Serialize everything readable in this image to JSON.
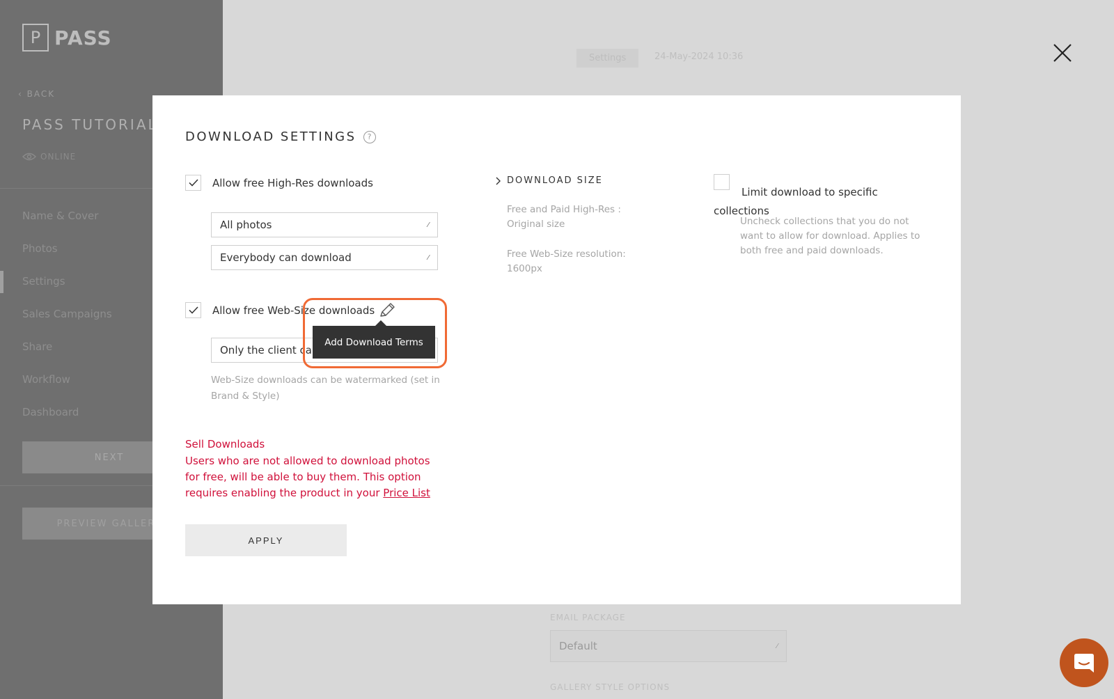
{
  "background": {
    "logo_letter": "P",
    "logo_text": "PASS",
    "back_label": "BACK",
    "gallery_title": "PASS TUTORIALS",
    "status": "ONLINE",
    "nav_items": [
      "Name & Cover",
      "Photos",
      "Settings",
      "Sales Campaigns",
      "Share",
      "Workflow",
      "Dashboard"
    ],
    "next_label": "NEXT",
    "preview_label": "PREVIEW GALLERY",
    "tab_label": "Settings",
    "date": "24-May-2024 10:36",
    "email_package_label": "EMAIL PACKAGE",
    "email_package_value": "Default",
    "gallery_style_label": "GALLERY STYLE OPTIONS"
  },
  "modal": {
    "title": "DOWNLOAD SETTINGS",
    "help_glyph": "?",
    "high_res": {
      "label": "Allow free High-Res downloads",
      "checked": true,
      "photos_select": "All photos",
      "who_select": "Everybody can download"
    },
    "web_size": {
      "label": "Allow free Web-Size downloads",
      "checked": true,
      "who_select": "Only the client can",
      "hint": "Web-Size downloads can be watermarked (set in Brand & Style)"
    },
    "tooltip": "Add Download Terms",
    "sell": {
      "title": "Sell Downloads",
      "text": "Users who are not allowed to download photos for free, will be able to buy them. This option requires enabling the product in your",
      "link": "Price List"
    },
    "apply_label": "APPLY",
    "download_size": {
      "heading": "DOWNLOAD SIZE",
      "high_res_label": "Free and Paid High-Res :",
      "high_res_value": "Original size",
      "web_label": "Free Web-Size resolution:",
      "web_value": "1600px"
    },
    "limit": {
      "label": "Limit download to specific collections",
      "checked": false,
      "hint": "Uncheck collections that you do not want to allow for download. Applies to both free and paid downloads."
    }
  },
  "colors": {
    "accent_red": "#d0103a",
    "highlight_orange": "#f06a35",
    "chat_button": "#c0541d"
  }
}
